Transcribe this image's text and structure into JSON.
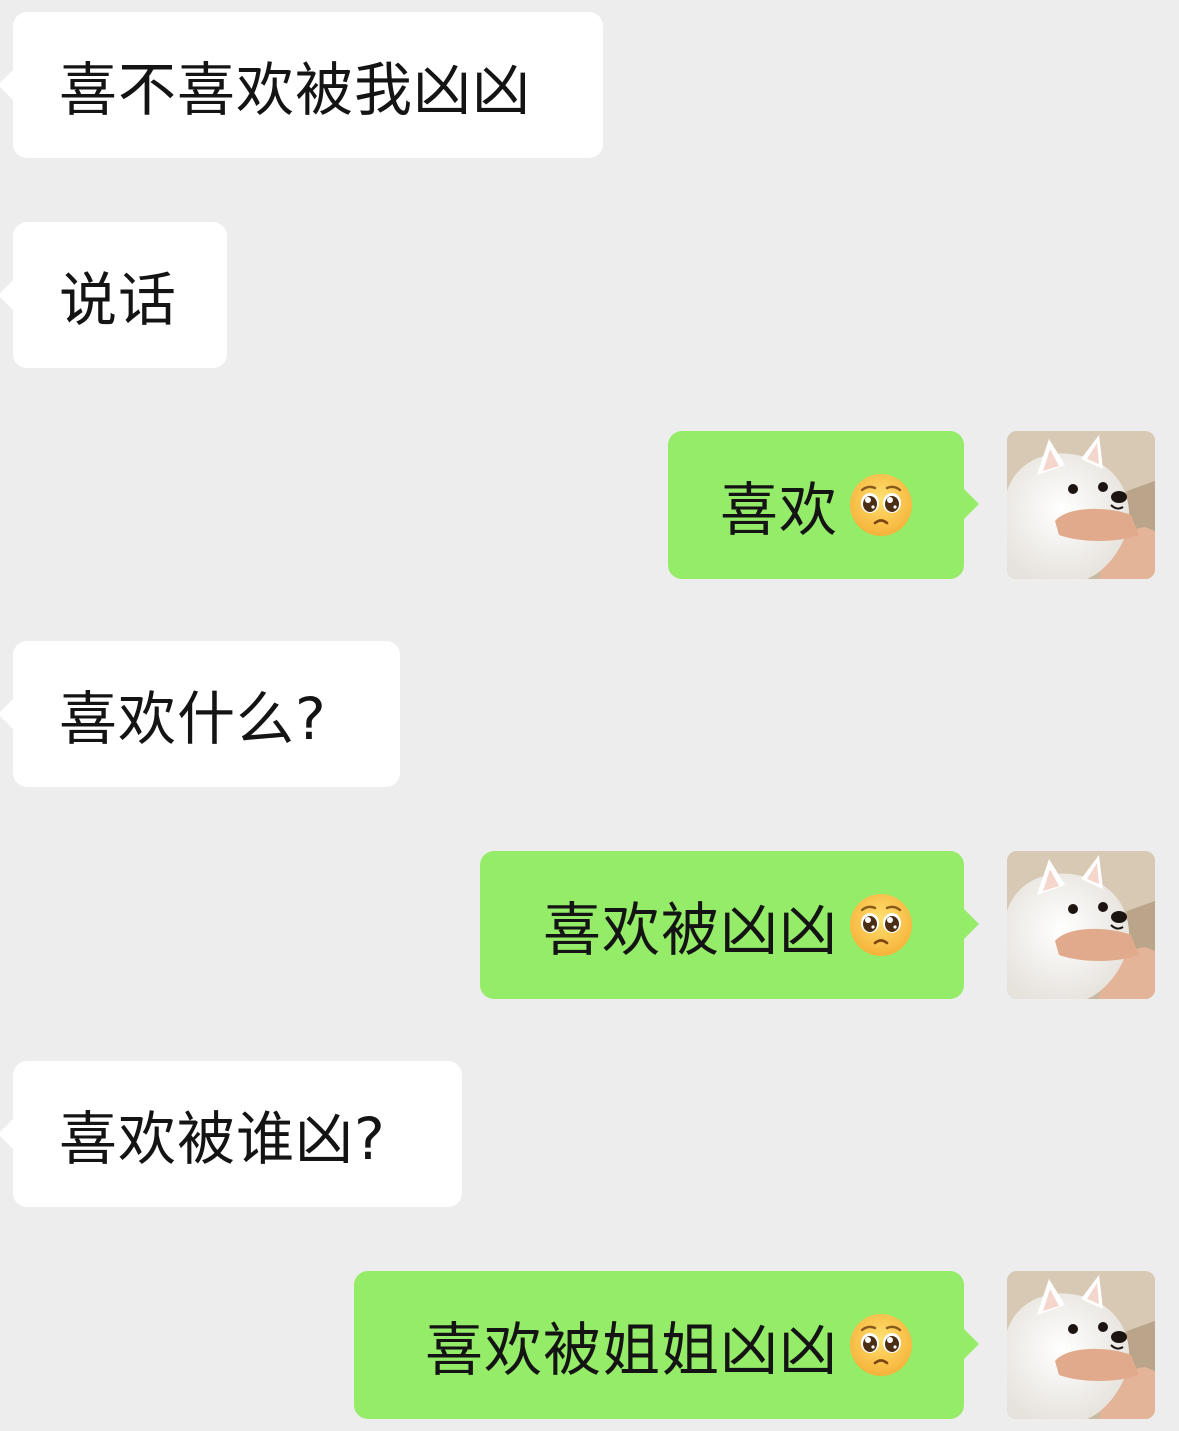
{
  "messages": [
    {
      "side": "in",
      "text": "喜不喜欢被我凶凶"
    },
    {
      "side": "in",
      "text": "说话"
    },
    {
      "side": "out",
      "text": "喜欢",
      "emoji": "pleading-face-icon"
    },
    {
      "side": "in",
      "text": "喜欢什么?"
    },
    {
      "side": "out",
      "text": "喜欢被凶凶",
      "emoji": "pleading-face-icon"
    },
    {
      "side": "in",
      "text": "喜欢被谁凶?"
    },
    {
      "side": "out",
      "text": "喜欢被姐姐凶凶",
      "emoji": "pleading-face-icon"
    }
  ],
  "avatar": {
    "icon": "samoyed-dog-avatar-icon"
  },
  "colors": {
    "background": "#ededed",
    "incoming_bubble": "#ffffff",
    "outgoing_bubble": "#95ec69",
    "text": "#141414"
  }
}
